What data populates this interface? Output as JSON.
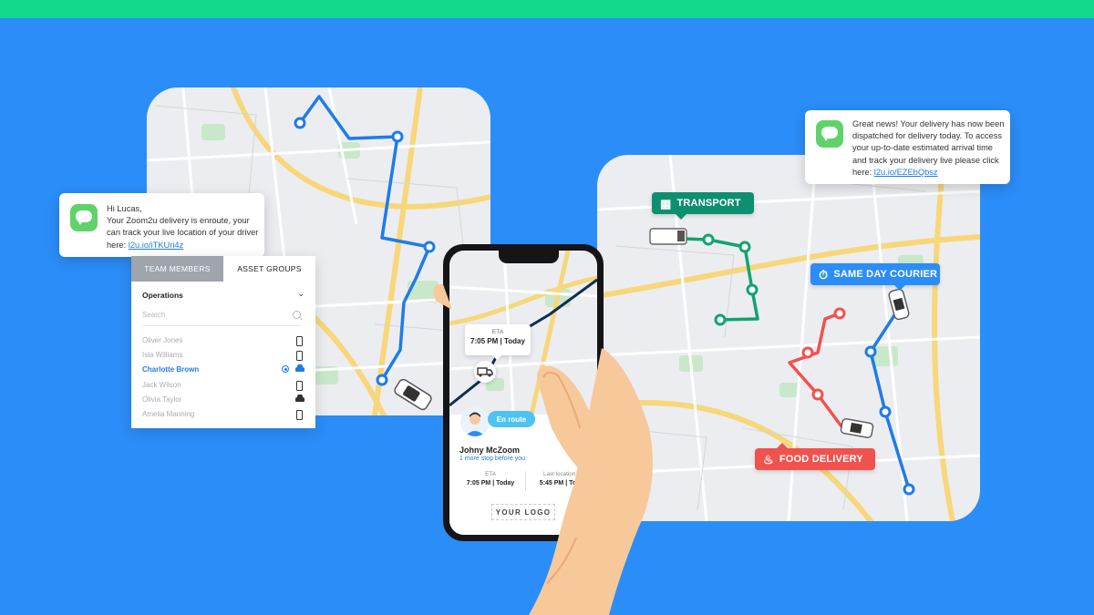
{
  "sms_left": {
    "lines": [
      "Hi Lucas,",
      "Your Zoom2u delivery is enroute, your",
      "can track your live location of your driver"
    ],
    "prefix": "here: ",
    "link": "l2u.io/iTKUri4z"
  },
  "sms_right": {
    "lines": [
      "Great news! Your delivery has now been",
      "dispatched for delivery today. To access",
      "your up-to-date estimated arrival time",
      "and track your delivery live please click"
    ],
    "prefix": "here: ",
    "link": "l2u.io/EZEbQbsz"
  },
  "panel": {
    "tabs": [
      "TEAM MEMBERS",
      "ASSET GROUPS"
    ],
    "group": "Operations",
    "search_placeholder": "Search",
    "people": [
      {
        "name": "Oliver Jones",
        "icon": "phone-icon"
      },
      {
        "name": "Isla Williams",
        "icon": "phone-icon"
      },
      {
        "name": "Charlotte Brown",
        "icon": "car-icon",
        "selected": true
      },
      {
        "name": "Jack Wilson",
        "icon": "phone-icon"
      },
      {
        "name": "Olivia Taylor",
        "icon": "car-icon"
      },
      {
        "name": "Amelia Manning",
        "icon": "phone-icon"
      }
    ]
  },
  "tags": {
    "transport": "TRANSPORT",
    "courier": "SAME DAY COURIER",
    "food": "FOOD DELIVERY"
  },
  "phone": {
    "popup_label": "ETA",
    "popup_value": "7:05 PM | Today",
    "status": "En route",
    "driver": "Johny McZoom",
    "subtitle": "1 more stop before you",
    "eta_label": "ETA",
    "eta_value": "7:05 PM | Today",
    "last_label": "Last location up",
    "last_value": "5:45 PM | Today",
    "logo": "YOUR LOGO"
  },
  "colors": {
    "background": "#2B8DF8",
    "top_bar": "#12D98C",
    "transport": "#0E8F6F",
    "courier": "#2B8DF8",
    "food": "#F0524E",
    "route_blue": "#1F7BE8"
  }
}
